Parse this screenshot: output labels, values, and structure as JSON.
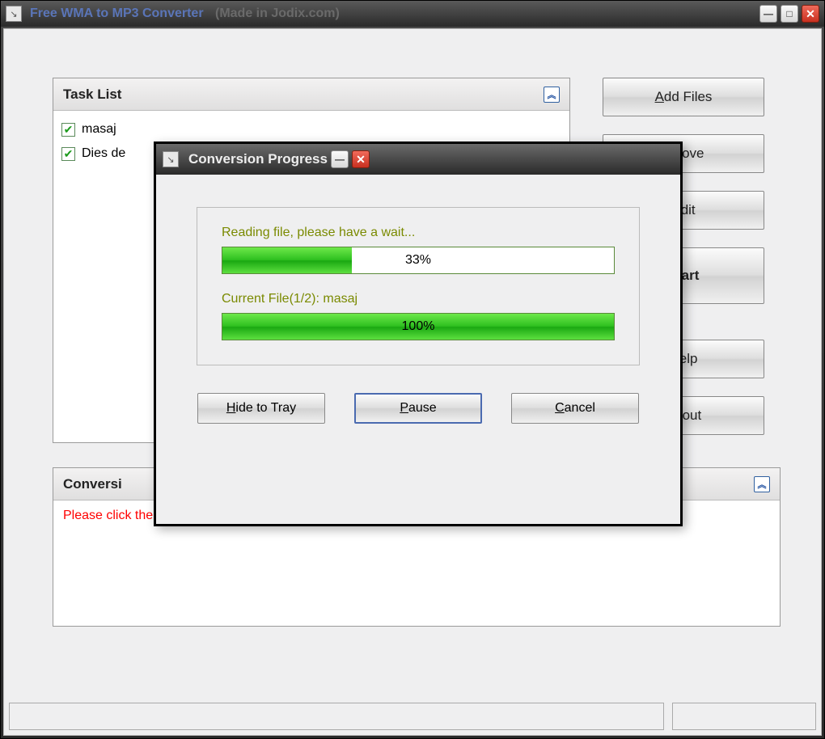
{
  "window": {
    "title": "Free WMA to MP3 Converter",
    "subtitle": "(Made in Jodix.com)"
  },
  "panels": {
    "task_list_title": "Task List",
    "log_title": "Conversi",
    "log_message": "Please click the \"Add Files\" button to add files."
  },
  "tasks": [
    {
      "checked": true,
      "name": "masaj"
    },
    {
      "checked": true,
      "name": "Dies de"
    }
  ],
  "buttons": {
    "add_files": "Add Files",
    "remove": "emove",
    "edit": "Edit",
    "start": "Start",
    "help": "Help",
    "about": "About"
  },
  "dialog": {
    "title": "Conversion Progress",
    "reading_label": "Reading file, please have a wait...",
    "reading_pct": "33%",
    "reading_fill": 33,
    "current_label": "Current File(1/2): masaj",
    "current_pct": "100%",
    "current_fill": 100,
    "hide_to_tray": "Hide to Tray",
    "pause": "Pause",
    "cancel": "Cancel"
  }
}
